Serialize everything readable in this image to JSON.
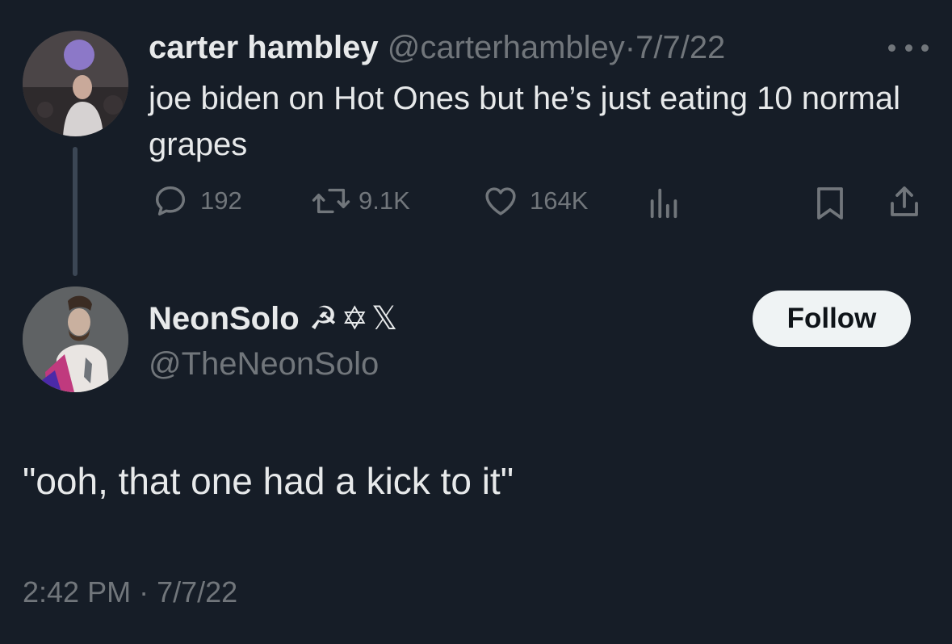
{
  "colors": {
    "background": "#161d27",
    "primary_text": "#e7e9ea",
    "secondary_text": "#71767b",
    "thread_line": "#3b4654",
    "follow_button_bg": "#eff3f4"
  },
  "parent_tweet": {
    "display_name": "carter hambley",
    "handle": "@carterhambley",
    "separator": "·",
    "date": "7/7/22",
    "text": "joe biden on Hot Ones but he’s just eating 10 normal grapes",
    "more_icon": "more-horizontal-icon",
    "actions": {
      "reply": {
        "icon": "reply-bubble-icon",
        "count": "192"
      },
      "retweet": {
        "icon": "retweet-icon",
        "count": "9.1K"
      },
      "like": {
        "icon": "heart-icon",
        "count": "164K"
      },
      "views": {
        "icon": "views-bar-chart-icon"
      },
      "bookmark": {
        "icon": "bookmark-icon"
      },
      "share": {
        "icon": "share-upload-icon"
      }
    }
  },
  "reply_tweet": {
    "display_name": "NeonSolo",
    "name_emojis": "☭✡𝕏",
    "handle": "@TheNeonSolo",
    "follow_label": "Follow",
    "text": "\"ooh, that one had a kick to it\"",
    "time": "2:42 PM",
    "separator": "·",
    "date": "7/7/22"
  }
}
